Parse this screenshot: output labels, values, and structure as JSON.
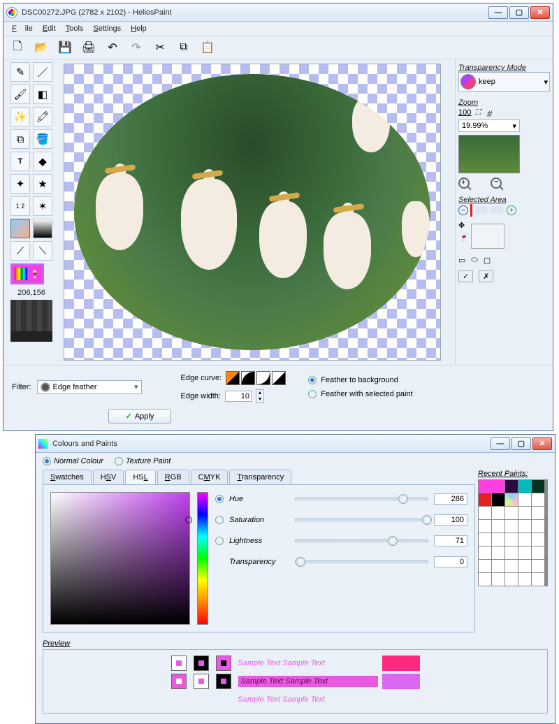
{
  "main_window": {
    "title": "DSC00272.JPG (2782 x 2102) - HeliosPaint",
    "menu": [
      "File",
      "Edit",
      "Tools",
      "Settings",
      "Help"
    ],
    "coords": "208,156",
    "options": {
      "filter_label": "Filter:",
      "filter_value": "Edge feather",
      "apply_label": "Apply",
      "edge_curve_label": "Edge curve:",
      "edge_width_label": "Edge width:",
      "edge_width_value": "10",
      "feather_bg": "Feather to background",
      "feather_paint": "Feather with selected paint"
    },
    "right": {
      "transparency_title": "Transparency Mode",
      "transparency_value": "keep",
      "zoom_title": "Zoom",
      "zoom_value": "19.99%",
      "selected_area_title": "Selected Area"
    }
  },
  "color_window": {
    "title": "Colours and Paints",
    "mode_normal": "Normal Colour",
    "mode_texture": "Texture Paint",
    "tabs": [
      "Swatches",
      "HSV",
      "HSL",
      "RGB",
      "CMYK",
      "Transparency"
    ],
    "active_tab": "HSL",
    "sliders": {
      "hue_label": "Hue",
      "hue": "286",
      "sat_label": "Saturation",
      "sat": "100",
      "light_label": "Lightness",
      "light": "71",
      "trans_label": "Transparency",
      "trans": "0"
    },
    "recent_title": "Recent Paints:",
    "recent_colors": [
      "#ff3ee0",
      "#ff3ee0",
      "#1b0a2b",
      "#00babc",
      "#e02424",
      "#000000",
      "#7fa0e8",
      "#ffffff",
      "#0b3b28"
    ],
    "preview_title": "Preview",
    "sample_text": "Sample Text  Sample Text"
  }
}
